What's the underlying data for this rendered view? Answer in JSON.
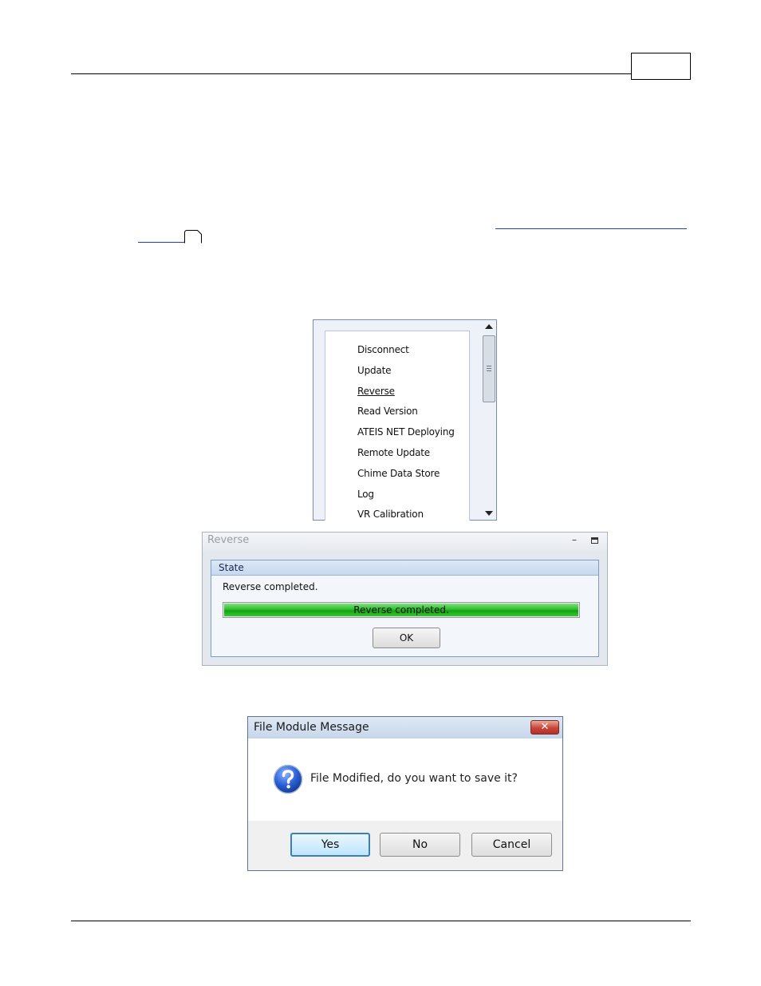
{
  "page": {
    "page_number": ""
  },
  "context_menu": {
    "items": [
      {
        "label": "Disconnect",
        "underlined": false
      },
      {
        "label": "Update",
        "underlined": false
      },
      {
        "label": "Reverse",
        "underlined": true
      },
      {
        "label": "Read Version",
        "underlined": false
      },
      {
        "label": "ATEIS NET Deploying",
        "underlined": false
      },
      {
        "label": "Remote Update",
        "underlined": false
      },
      {
        "label": "Chime Data Store",
        "underlined": false
      },
      {
        "label": "Log",
        "underlined": false
      },
      {
        "label": "VR Calibration",
        "underlined": false
      }
    ]
  },
  "reverse_dialog": {
    "title": "Reverse",
    "group_label": "State",
    "status_text": "Reverse completed.",
    "progress_text": "Reverse completed.",
    "progress_fraction": 1.0,
    "ok_label": "OK",
    "progress_color": "#22b322"
  },
  "message_dialog": {
    "title": "File Module Message",
    "close_symbol": "✕",
    "icon": "question-icon",
    "message": "File Modified, do you want to save it?",
    "buttons": {
      "yes": "Yes",
      "no": "No",
      "cancel": "Cancel"
    }
  }
}
